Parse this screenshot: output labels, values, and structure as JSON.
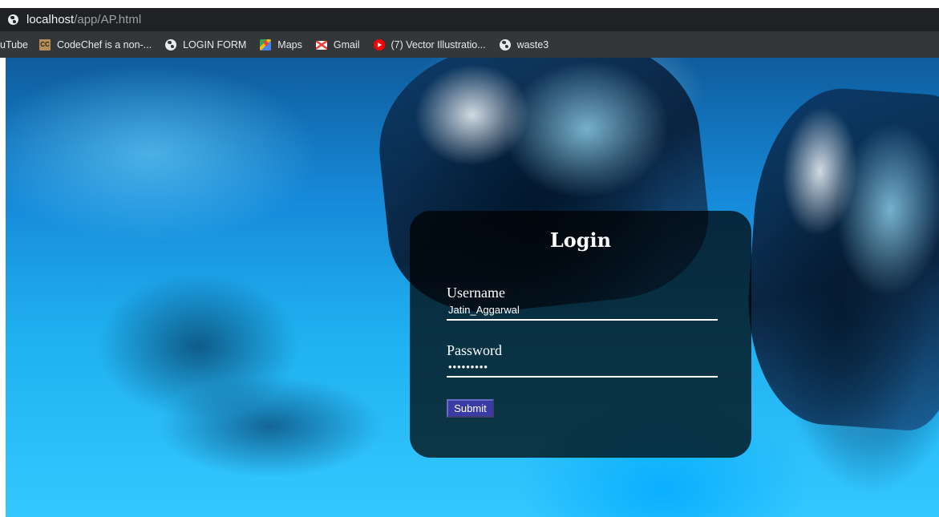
{
  "browser": {
    "url_host": "localhost",
    "url_path": "/app/AP.html",
    "bookmarks": [
      {
        "label": "uTube",
        "icon": ""
      },
      {
        "label": "CodeChef is a non-...",
        "icon": "codechef-icon"
      },
      {
        "label": "LOGIN FORM",
        "icon": "globe-icon"
      },
      {
        "label": "Maps",
        "icon": "maps-icon"
      },
      {
        "label": "Gmail",
        "icon": "gmail-icon"
      },
      {
        "label": "(7) Vector Illustratio...",
        "icon": "youtube-icon"
      },
      {
        "label": "waste3",
        "icon": "globe-icon"
      }
    ],
    "codechef_icon_text": "CC"
  },
  "login": {
    "title": "Login",
    "username_label": "Username",
    "username_value": "Jatin_Aggarwal",
    "password_label": "Password",
    "password_value": "•••••••••",
    "submit_label": "Submit"
  },
  "colors": {
    "card_bg": "#000000",
    "submit_bg": "#3b3ba8",
    "addressbar_bg": "#202124",
    "bookmarks_bg": "#35363a"
  }
}
